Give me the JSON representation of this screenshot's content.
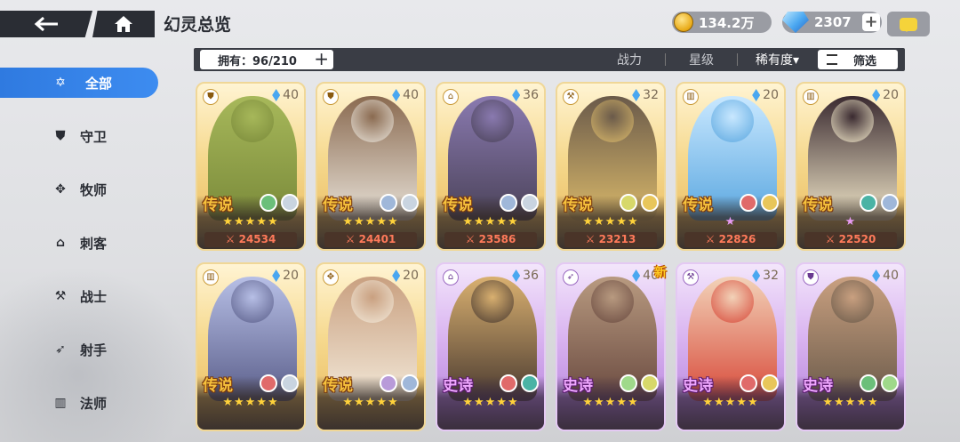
{
  "header": {
    "title": "幻灵总览",
    "gold": "134.2万",
    "gems": "2307",
    "back_icon": "back-arrow-icon",
    "home_icon": "home-icon"
  },
  "filterbar": {
    "owned": "拥有：96/210",
    "sort_power": "战力",
    "sort_star": "星级",
    "sort_rarity": "稀有度▾",
    "filter": "筛选"
  },
  "sidebar": {
    "items": [
      {
        "label": "全部",
        "icon": "all-icon",
        "active": true
      },
      {
        "label": "守卫",
        "icon": "shield-icon"
      },
      {
        "label": "牧师",
        "icon": "wings-icon"
      },
      {
        "label": "刺客",
        "icon": "hood-icon"
      },
      {
        "label": "战士",
        "icon": "axe-icon"
      },
      {
        "label": "射手",
        "icon": "bow-icon"
      },
      {
        "label": "法师",
        "icon": "book-icon"
      }
    ]
  },
  "badge_new": "新",
  "cards": [
    {
      "tier": "传说",
      "level": "40",
      "power": "24534",
      "stars": "★★★★★",
      "class_icon": "shield-icon",
      "elements": [
        "#6bbf7a",
        "#c9d4e0"
      ]
    },
    {
      "tier": "传说",
      "level": "40",
      "power": "24401",
      "stars": "★★★★★",
      "class_icon": "shield-icon",
      "elements": [
        "#9fb7d9",
        "#c9d4e0"
      ]
    },
    {
      "tier": "传说",
      "level": "36",
      "power": "23586",
      "stars": "★★★★★",
      "class_icon": "hood-icon",
      "elements": [
        "#9fb7d9",
        "#c9d4e0"
      ]
    },
    {
      "tier": "传说",
      "level": "32",
      "power": "23213",
      "stars": "★★★★★",
      "class_icon": "axe-icon",
      "elements": [
        "#d7d86a",
        "#e8c65a"
      ]
    },
    {
      "tier": "传说",
      "level": "20",
      "power": "22826",
      "stars": "★",
      "class_icon": "book-icon",
      "elements": [
        "#e06a6a",
        "#e8c65a"
      ]
    },
    {
      "tier": "传说",
      "level": "20",
      "power": "22520",
      "stars": "★",
      "class_icon": "book-icon",
      "elements": [
        "#4ab3a5",
        "#9fb7d9"
      ]
    },
    {
      "tier": "传说",
      "level": "20",
      "power": "",
      "stars": "★★★★★",
      "class_icon": "book-icon",
      "elements": [
        "#e06a6a",
        "#c9d4e0"
      ]
    },
    {
      "tier": "传说",
      "level": "20",
      "power": "",
      "stars": "★★★★★",
      "class_icon": "wings-icon",
      "elements": [
        "#b89ad9",
        "#9fb7d9"
      ]
    },
    {
      "tier": "史诗",
      "level": "36",
      "power": "",
      "stars": "★★★★★",
      "class_icon": "hood-icon",
      "elements": [
        "#e06a6a",
        "#4ab3a5"
      ]
    },
    {
      "tier": "史诗",
      "level": "40",
      "power": "",
      "stars": "★★★★★",
      "class_icon": "bow-icon",
      "elements": [
        "#9fd98a",
        "#d7d86a"
      ]
    },
    {
      "tier": "史诗",
      "level": "32",
      "power": "",
      "stars": "★★★★★",
      "class_icon": "axe-icon",
      "elements": [
        "#e06a6a",
        "#e8c65a"
      ]
    },
    {
      "tier": "史诗",
      "level": "40",
      "power": "",
      "stars": "★★★★★",
      "class_icon": "shield-icon",
      "elements": [
        "#6bbf7a",
        "#9fd98a"
      ]
    }
  ]
}
